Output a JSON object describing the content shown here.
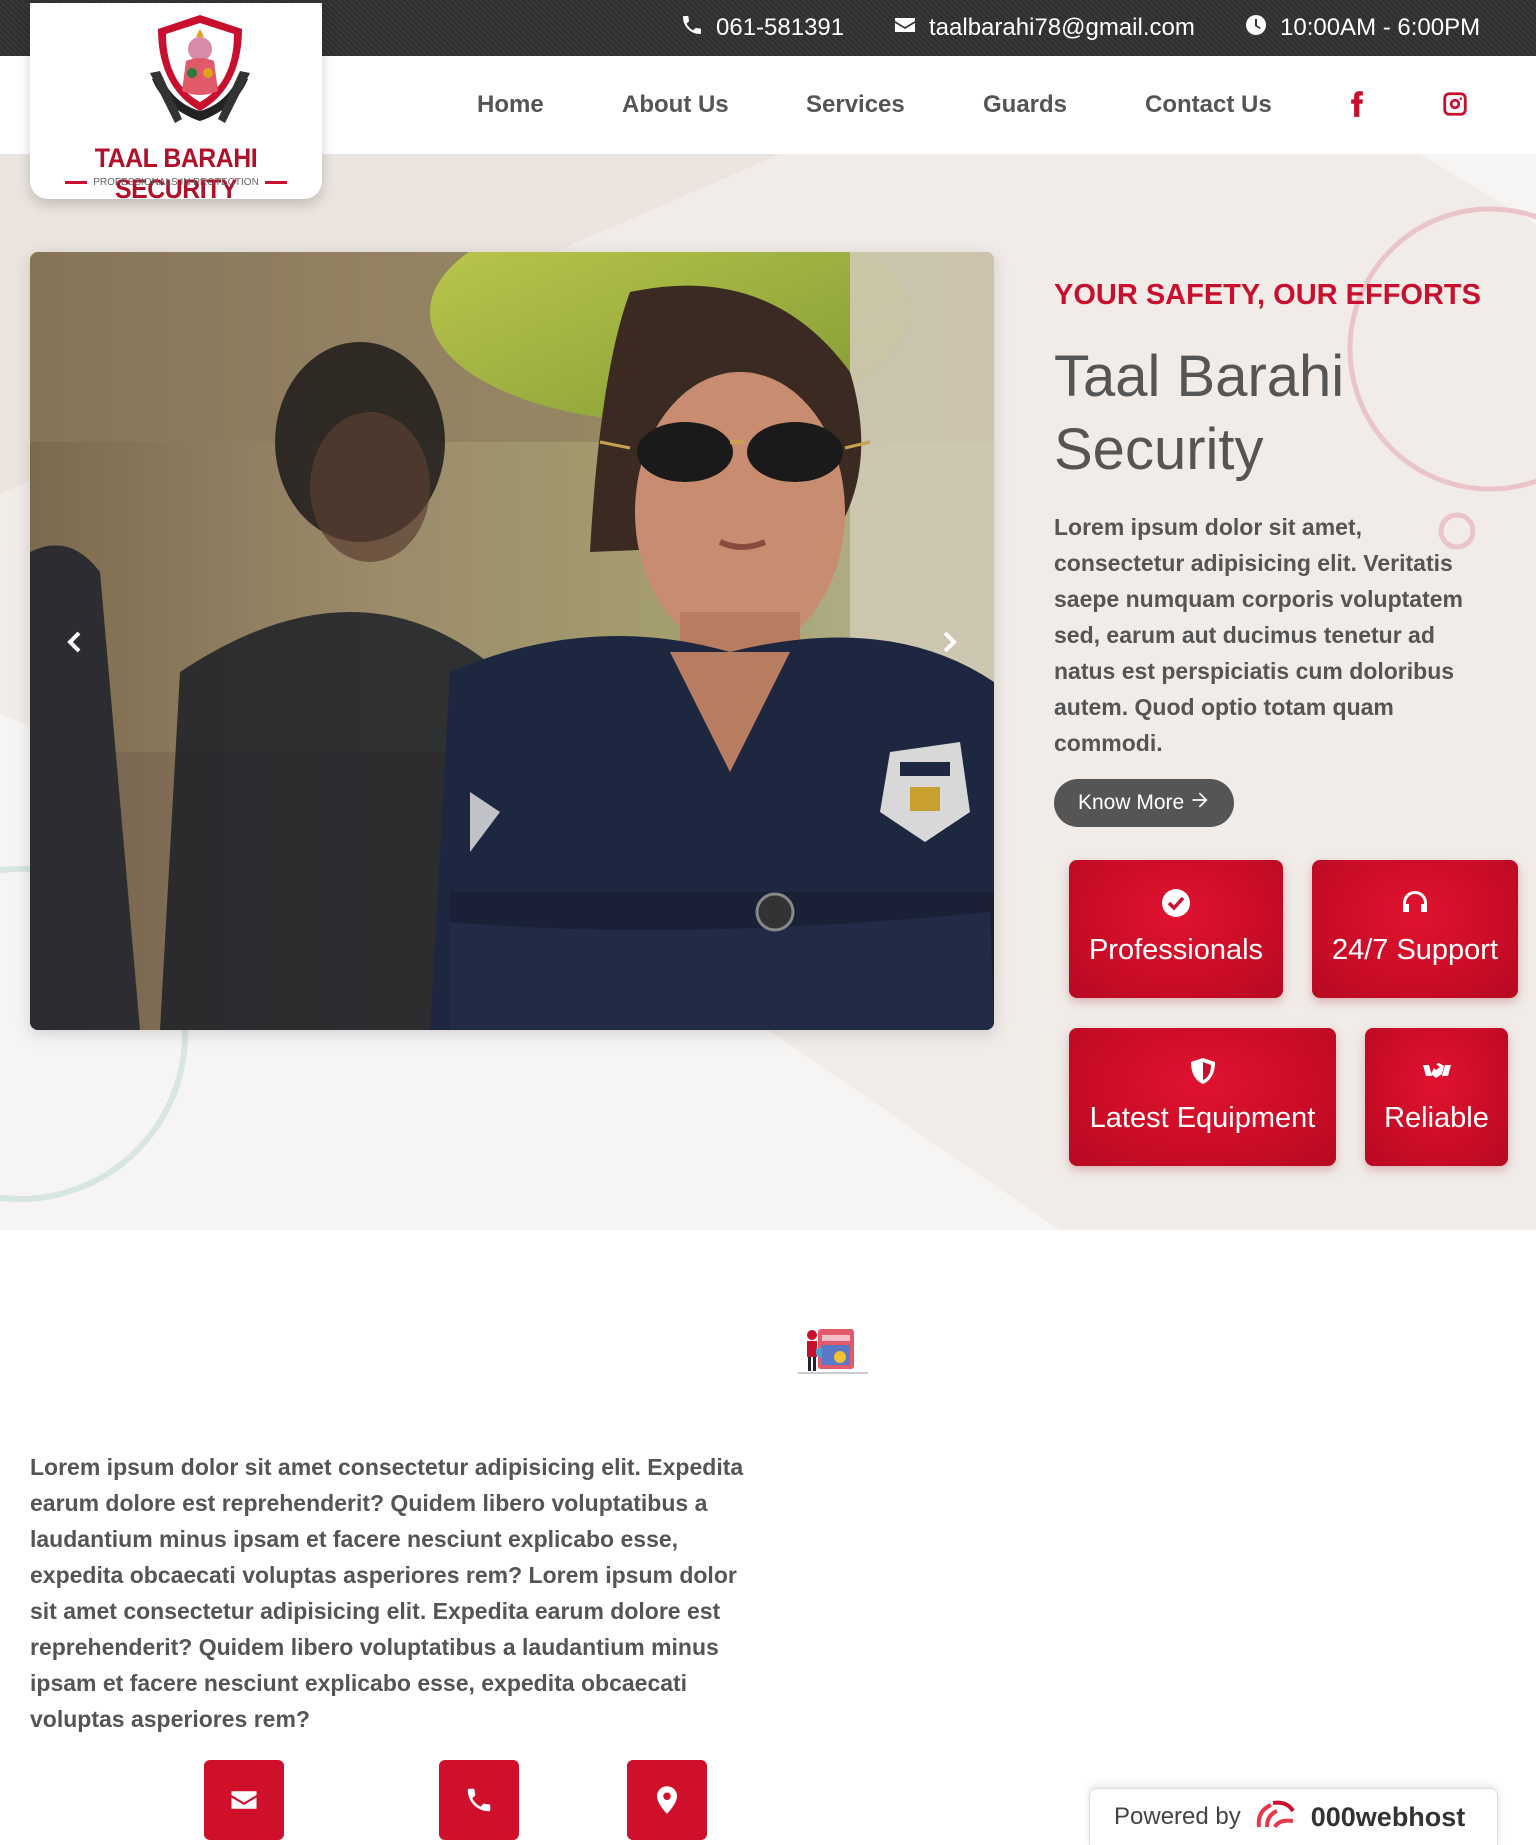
{
  "topbar": {
    "phone": "061-581391",
    "email": "taalbarahi78@gmail.com",
    "hours": "10:00AM - 6:00PM"
  },
  "logo": {
    "title": "TAAL BARAHI SECURITY",
    "tagline": "PROFESSIONALS IN PROTECTION"
  },
  "nav": {
    "items": [
      {
        "label": "Home"
      },
      {
        "label": "About Us"
      },
      {
        "label": "Services"
      },
      {
        "label": "Guards"
      },
      {
        "label": "Contact Us"
      }
    ],
    "social": [
      "facebook-icon",
      "instagram-icon"
    ]
  },
  "hero": {
    "eyebrow": "YOUR SAFETY, OUR EFFORTS",
    "title": "Taal Barahi Security",
    "text": "Lorem ipsum dolor sit amet, consectetur adipisicing elit. Veritatis saepe numquam corporis voluptatem sed, earum aut ducimus tenetur ad natus est perspiciatis cum doloribus autem. Quod optio totam quam commodi.",
    "button": "Know More",
    "features": [
      {
        "label": "Professionals",
        "icon": "check-circle-icon"
      },
      {
        "label": "24/7 Support",
        "icon": "headphones-icon"
      },
      {
        "label": "Latest Equipment",
        "icon": "shield-icon"
      },
      {
        "label": "Reliable",
        "icon": "handshake-icon"
      }
    ]
  },
  "about": {
    "text": "Lorem ipsum dolor sit amet consectetur adipisicing elit. Expedita earum dolore est reprehenderit? Quidem libero voluptatibus a laudantium minus ipsam et facere nesciunt explicabo esse, expedita obcaecati voluptas asperiores rem? Lorem ipsum dolor sit amet consectetur adipisicing elit. Expedita earum dolore est reprehenderit? Quidem libero voluptatibus a laudantium minus ipsam et facere nesciunt explicabo esse, expedita obcaecati voluptas asperiores rem?",
    "contact_buttons": [
      "envelope-icon",
      "phone-icon",
      "map-marker-icon"
    ]
  },
  "powered": {
    "prefix": "Powered by",
    "brand": "000webhost"
  },
  "colors": {
    "accent": "#c8102e",
    "topbar": "#333333",
    "hero_bg": "#f1ece8",
    "text": "#555555"
  }
}
